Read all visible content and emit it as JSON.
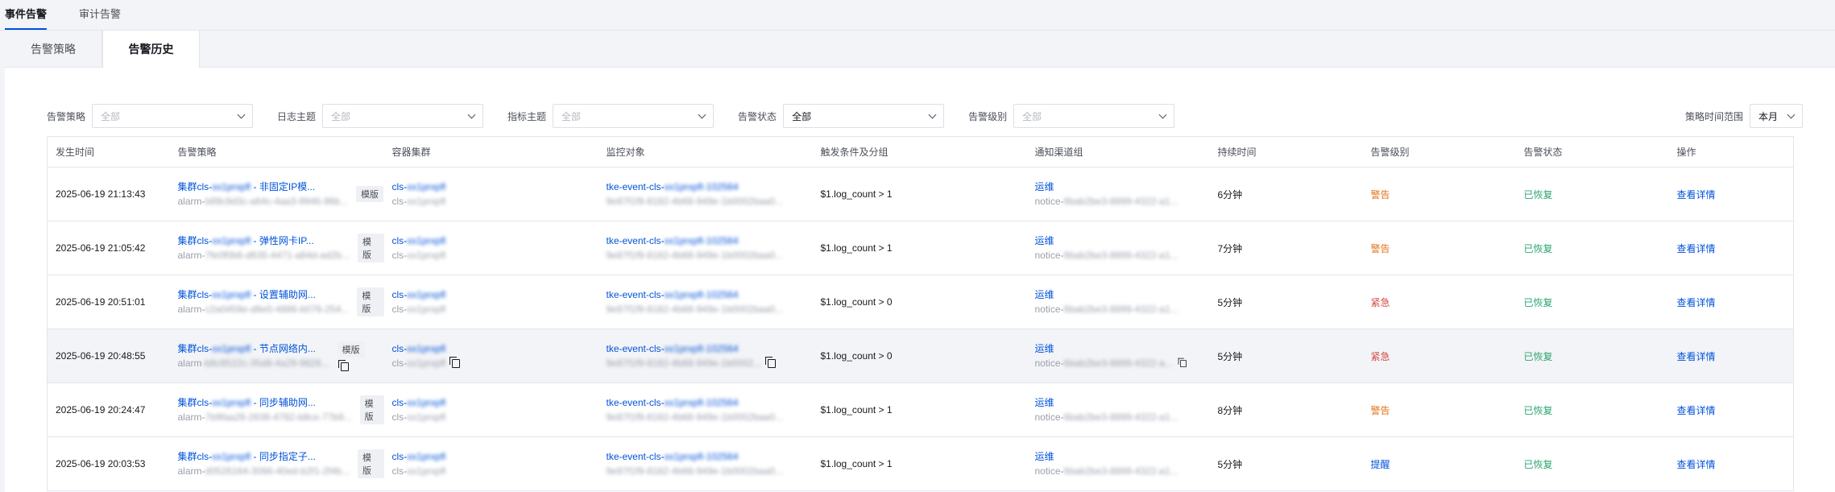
{
  "top_tabs": [
    {
      "label": "事件告警",
      "active": true
    },
    {
      "label": "审计告警",
      "active": false
    }
  ],
  "sub_tabs": [
    {
      "label": "告警策略",
      "active": false
    },
    {
      "label": "告警历史",
      "active": true
    }
  ],
  "filters": {
    "strategy": {
      "label": "告警策略",
      "value": "全部",
      "is_placeholder": true
    },
    "log_topic": {
      "label": "日志主题",
      "value": "全部",
      "is_placeholder": true
    },
    "metric_topic": {
      "label": "指标主题",
      "value": "全部",
      "is_placeholder": true
    },
    "alarm_status": {
      "label": "告警状态",
      "value": "全部",
      "is_placeholder": false
    },
    "alarm_level": {
      "label": "告警级别",
      "value": "全部",
      "is_placeholder": true
    },
    "time_range": {
      "label": "策略时间范围",
      "value": "本月"
    }
  },
  "table": {
    "columns": [
      "发生时间",
      "告警策略",
      "容器集群",
      "监控对象",
      "触发条件及分组",
      "通知渠道组",
      "持续时间",
      "告警级别",
      "告警状态",
      "操作"
    ],
    "rows": [
      {
        "time": "2025-06-19 21:13:43",
        "strategy_prefix": "集群cls-",
        "strategy_masked": "xx1prxpfl",
        "strategy_suffix": " - 非固定IP模...",
        "strategy_sub_prefix": "alarm-",
        "strategy_sub_masked": "b89c9d3c-a64c-4aa3-9946-96b...",
        "tag": "模版",
        "cluster": "cls-",
        "cluster_masked": "xx1prxpfl",
        "cluster_sub": "cls-",
        "cluster_sub_masked": "xx1prxpfl",
        "target": "tke-event-cls-",
        "target_masked": "xx1prxpfl-102564",
        "target_sub_masked": "9e87f1f9-8182-4b68-949e-1b0002baa0...",
        "condition": "$1.log_count > 1",
        "channel": "运维",
        "channel_sub": "notice-",
        "channel_sub_masked": "6bab2be3-8899-4322-a1...",
        "duration": "6分钟",
        "level": "警告",
        "level_class": "lvl-warn",
        "status": "已恢复",
        "action": "查看详情"
      },
      {
        "time": "2025-06-19 21:05:42",
        "strategy_prefix": "集群cls-",
        "strategy_masked": "xx1prxpfl",
        "strategy_suffix": " - 弹性网卡IP...",
        "strategy_sub_prefix": "alarm-",
        "strategy_sub_masked": "7fe0f0b6-d635-4471-a84d-ad2b...",
        "tag": "模版",
        "cluster": "cls-",
        "cluster_masked": "xx1prxpfl",
        "cluster_sub": "cls-",
        "cluster_sub_masked": "xx1prxpfl",
        "target": "tke-event-cls-",
        "target_masked": "xx1prxpfl-102564",
        "target_sub_masked": "9e87f1f9-8182-4b68-949e-1b0002baa0...",
        "condition": "$1.log_count > 1",
        "channel": "运维",
        "channel_sub": "notice-",
        "channel_sub_masked": "6bab2be3-8899-4322-a1...",
        "duration": "7分钟",
        "level": "警告",
        "level_class": "lvl-warn",
        "status": "已恢复",
        "action": "查看详情"
      },
      {
        "time": "2025-06-19 20:51:01",
        "strategy_prefix": "集群cls-",
        "strategy_masked": "xx1prxpfl",
        "strategy_suffix": " - 设置辅助网...",
        "strategy_sub_prefix": "alarm-",
        "strategy_sub_masked": "c2a0459e-d8e0-4886-b076-254...",
        "tag": "模版",
        "cluster": "cls-",
        "cluster_masked": "xx1prxpfl",
        "cluster_sub": "cls-",
        "cluster_sub_masked": "xx1prxpfl",
        "target": "tke-event-cls-",
        "target_masked": "xx1prxpfl-102564",
        "target_sub_masked": "9e87f1f9-8182-4b68-949e-1b0002baa0...",
        "condition": "$1.log_count > 0",
        "channel": "运维",
        "channel_sub": "notice-",
        "channel_sub_masked": "6bab2be3-8899-4322-a1...",
        "duration": "5分钟",
        "level": "紧急",
        "level_class": "lvl-urgent",
        "status": "已恢复",
        "action": "查看详情"
      },
      {
        "time": "2025-06-19 20:48:55",
        "strategy_prefix": "集群cls-",
        "strategy_masked": "xx1prxpfl",
        "strategy_suffix": " - 节点网络内...",
        "strategy_sub_prefix": "alarm",
        "strategy_sub_masked": "-b8c8522c-35d8-4a29-9826...",
        "tag": "模版",
        "cluster": "cls-",
        "cluster_masked": "xx1prxpfl",
        "cluster_sub": "cls-",
        "cluster_sub_masked": "xx1prxpfl",
        "target": "tke-event-cls-",
        "target_masked": "xx1prxpfl-102564",
        "target_sub_masked": "9e87f1f9-8182-4b68-949e-1b0002...",
        "condition": "$1.log_count > 0",
        "channel": "运维",
        "channel_sub": "notice-",
        "channel_sub_masked": "6bab2be3-8899-4322-a...",
        "duration": "5分钟",
        "level": "紧急",
        "level_class": "lvl-urgent",
        "status": "已恢复",
        "action": "查看详情",
        "hovered": true
      },
      {
        "time": "2025-06-19 20:24:47",
        "strategy_prefix": "集群cls-",
        "strategy_masked": "xx1prxpfl",
        "strategy_suffix": " - 同步辅助网...",
        "strategy_sub_prefix": "alarm-",
        "strategy_sub_masked": "7b9faa26-2636-4782-b8ce-77b9...",
        "tag": "模版",
        "cluster": "cls-",
        "cluster_masked": "xx1prxpfl",
        "cluster_sub": "cls-",
        "cluster_sub_masked": "xx1prxpfl",
        "target": "tke-event-cls-",
        "target_masked": "xx1prxpfl-102564",
        "target_sub_masked": "9e87f1f9-8182-4b68-949e-1b0002baa0...",
        "condition": "$1.log_count > 1",
        "channel": "运维",
        "channel_sub": "notice-",
        "channel_sub_masked": "6bab2be3-8899-4322-a1...",
        "duration": "8分钟",
        "level": "警告",
        "level_class": "lvl-warn",
        "status": "已恢复",
        "action": "查看详情"
      },
      {
        "time": "2025-06-19 20:03:53",
        "strategy_prefix": "集群cls-",
        "strategy_masked": "xx1prxpfl",
        "strategy_suffix": " - 同步指定子...",
        "strategy_sub_prefix": "alarm-",
        "strategy_sub_masked": "d0526164-3066-40ed-b2f1-2f4b...",
        "tag": "模版",
        "cluster": "cls-",
        "cluster_masked": "xx1prxpfl",
        "cluster_sub": "cls-",
        "cluster_sub_masked": "xx1prxpfl",
        "target": "tke-event-cls-",
        "target_masked": "xx1prxpfl-102564",
        "target_sub_masked": "9e87f1f9-8182-4b68-949e-1b0002baa0...",
        "condition": "$1.log_count > 1",
        "channel": "运维",
        "channel_sub": "notice-",
        "channel_sub_masked": "6bab2be3-8899-4322-a1...",
        "duration": "5分钟",
        "level": "提醒",
        "level_class": "lvl-remind",
        "status": "已恢复",
        "action": "查看详情"
      }
    ]
  },
  "colors": {
    "accent": "#0052d9",
    "warn": "#e37318",
    "urgent": "#d54941",
    "ok": "#2ba471"
  }
}
